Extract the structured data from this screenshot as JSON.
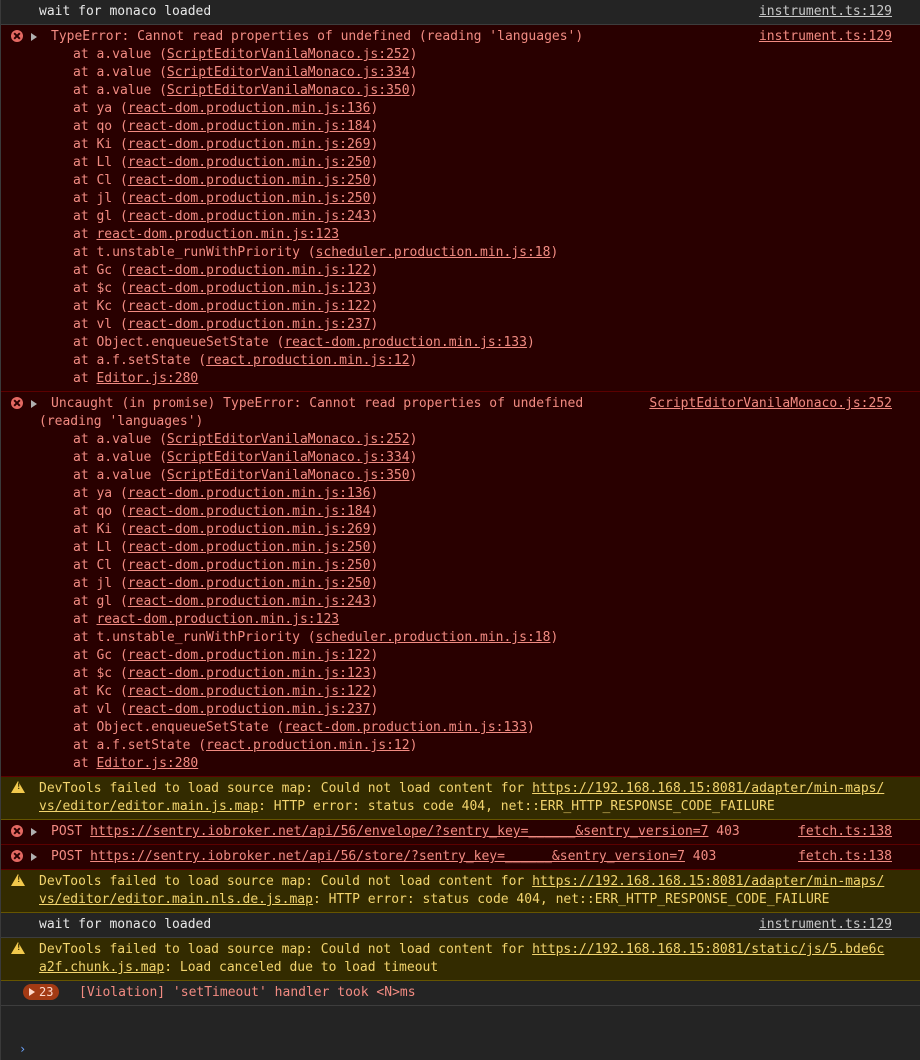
{
  "rows": [
    {
      "type": "info",
      "text": "wait for monaco loaded",
      "source": "instrument.ts:129"
    },
    {
      "type": "error",
      "text": "TypeError: Cannot read properties of undefined (reading 'languages')",
      "source": "instrument.ts:129",
      "stack": [
        {
          "fn": "at a.value (",
          "file": "ScriptEditorVanilaMonaco.js:252",
          "end": ")"
        },
        {
          "fn": "at a.value (",
          "file": "ScriptEditorVanilaMonaco.js:334",
          "end": ")"
        },
        {
          "fn": "at a.value (",
          "file": "ScriptEditorVanilaMonaco.js:350",
          "end": ")"
        },
        {
          "fn": "at ya (",
          "file": "react-dom.production.min.js:136",
          "end": ")"
        },
        {
          "fn": "at qo (",
          "file": "react-dom.production.min.js:184",
          "end": ")"
        },
        {
          "fn": "at Ki (",
          "file": "react-dom.production.min.js:269",
          "end": ")"
        },
        {
          "fn": "at Ll (",
          "file": "react-dom.production.min.js:250",
          "end": ")"
        },
        {
          "fn": "at Cl (",
          "file": "react-dom.production.min.js:250",
          "end": ")"
        },
        {
          "fn": "at jl (",
          "file": "react-dom.production.min.js:250",
          "end": ")"
        },
        {
          "fn": "at gl (",
          "file": "react-dom.production.min.js:243",
          "end": ")"
        },
        {
          "fn": "at ",
          "file": "react-dom.production.min.js:123",
          "end": ""
        },
        {
          "fn": "at t.unstable_runWithPriority (",
          "file": "scheduler.production.min.js:18",
          "end": ")"
        },
        {
          "fn": "at Gc (",
          "file": "react-dom.production.min.js:122",
          "end": ")"
        },
        {
          "fn": "at $c (",
          "file": "react-dom.production.min.js:123",
          "end": ")"
        },
        {
          "fn": "at Kc (",
          "file": "react-dom.production.min.js:122",
          "end": ")"
        },
        {
          "fn": "at vl (",
          "file": "react-dom.production.min.js:237",
          "end": ")"
        },
        {
          "fn": "at Object.enqueueSetState (",
          "file": "react-dom.production.min.js:133",
          "end": ")"
        },
        {
          "fn": "at a.f.setState (",
          "file": "react.production.min.js:12",
          "end": ")"
        },
        {
          "fn": "at ",
          "file": "Editor.js:280",
          "end": ""
        }
      ]
    },
    {
      "type": "error",
      "text": "Uncaught (in promise) TypeError: Cannot read properties of undefined",
      "text2": "(reading 'languages')",
      "source": "ScriptEditorVanilaMonaco.js:252",
      "stack": [
        {
          "fn": "at a.value (",
          "file": "ScriptEditorVanilaMonaco.js:252",
          "end": ")"
        },
        {
          "fn": "at a.value (",
          "file": "ScriptEditorVanilaMonaco.js:334",
          "end": ")"
        },
        {
          "fn": "at a.value (",
          "file": "ScriptEditorVanilaMonaco.js:350",
          "end": ")"
        },
        {
          "fn": "at ya (",
          "file": "react-dom.production.min.js:136",
          "end": ")"
        },
        {
          "fn": "at qo (",
          "file": "react-dom.production.min.js:184",
          "end": ")"
        },
        {
          "fn": "at Ki (",
          "file": "react-dom.production.min.js:269",
          "end": ")"
        },
        {
          "fn": "at Ll (",
          "file": "react-dom.production.min.js:250",
          "end": ")"
        },
        {
          "fn": "at Cl (",
          "file": "react-dom.production.min.js:250",
          "end": ")"
        },
        {
          "fn": "at jl (",
          "file": "react-dom.production.min.js:250",
          "end": ")"
        },
        {
          "fn": "at gl (",
          "file": "react-dom.production.min.js:243",
          "end": ")"
        },
        {
          "fn": "at ",
          "file": "react-dom.production.min.js:123",
          "end": ""
        },
        {
          "fn": "at t.unstable_runWithPriority (",
          "file": "scheduler.production.min.js:18",
          "end": ")"
        },
        {
          "fn": "at Gc (",
          "file": "react-dom.production.min.js:122",
          "end": ")"
        },
        {
          "fn": "at $c (",
          "file": "react-dom.production.min.js:123",
          "end": ")"
        },
        {
          "fn": "at Kc (",
          "file": "react-dom.production.min.js:122",
          "end": ")"
        },
        {
          "fn": "at vl (",
          "file": "react-dom.production.min.js:237",
          "end": ")"
        },
        {
          "fn": "at Object.enqueueSetState (",
          "file": "react-dom.production.min.js:133",
          "end": ")"
        },
        {
          "fn": "at a.f.setState (",
          "file": "react.production.min.js:12",
          "end": ")"
        },
        {
          "fn": "at ",
          "file": "Editor.js:280",
          "end": ""
        }
      ]
    },
    {
      "type": "warn",
      "prefix": "DevTools failed to load source map: Could not load content for ",
      "url": "https://192.168.168.15:8081/adapter/min-maps/vs/editor/editor.main.js.map",
      "suffix": ": HTTP error: status code 404, net::ERR_HTTP_RESPONSE_CODE_FAILURE"
    },
    {
      "type": "error-net",
      "method": "POST",
      "url": "https://sentry.iobroker.net/api/56/envelope/?sentry_key=______&sentry_version=7",
      "status": "403",
      "source": "fetch.ts:138"
    },
    {
      "type": "error-net",
      "method": "POST",
      "url": "https://sentry.iobroker.net/api/56/store/?sentry_key=______&sentry_version=7",
      "status": "403",
      "source": "fetch.ts:138"
    },
    {
      "type": "warn",
      "prefix": "DevTools failed to load source map: Could not load content for ",
      "url": "https://192.168.168.15:8081/adapter/min-maps/vs/editor/editor.main.nls.de.js.map",
      "suffix": ": HTTP error: status code 404, net::ERR_HTTP_RESPONSE_CODE_FAILURE"
    },
    {
      "type": "info",
      "text": "wait for monaco loaded",
      "source": "instrument.ts:129"
    },
    {
      "type": "warn",
      "prefix": "DevTools failed to load source map: Could not load content for ",
      "url": "https://192.168.168.15:8081/static/js/5.bde6ca2f.chunk.js.map",
      "suffix": ": Load canceled due to load timeout"
    },
    {
      "type": "violation",
      "count": "23",
      "text": "[Violation] 'setTimeout' handler took <N>ms"
    }
  ],
  "prompt": "›"
}
